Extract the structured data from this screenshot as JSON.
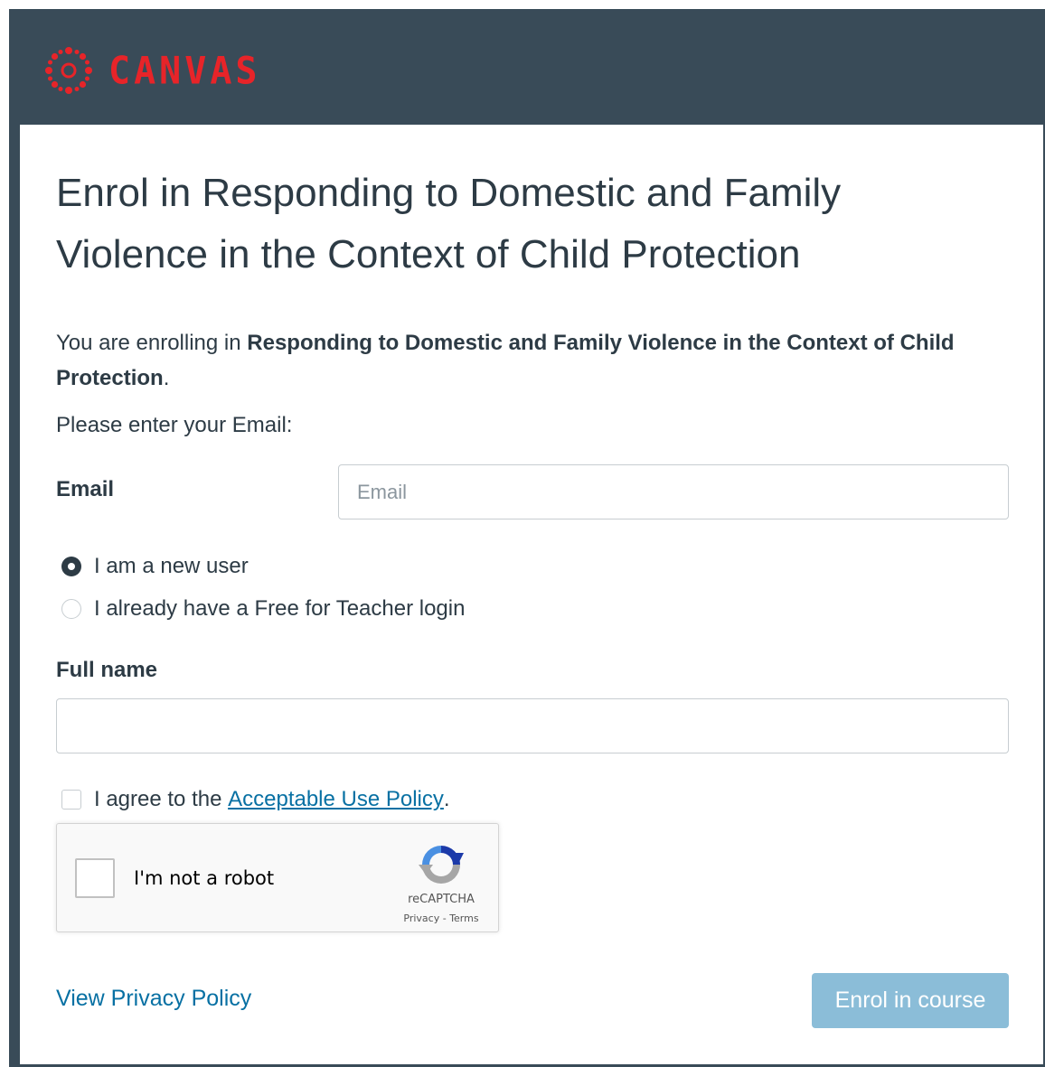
{
  "brand": {
    "name": "CANVAS",
    "color": "#e72429",
    "logo_icon": "canvas-logo-icon"
  },
  "page": {
    "title": "Enrol in Responding to Domestic and Family Violence in the Context of Child Protection",
    "intro_prefix": "You are enrolling in ",
    "course_name": "Responding to Domestic and Family Violence in the Context of Child Protection",
    "intro_suffix": ".",
    "prompt": "Please enter your Email:"
  },
  "form": {
    "email_label": "Email",
    "email_placeholder": "Email",
    "email_value": "",
    "user_options": [
      {
        "label": "I am a new user",
        "selected": true
      },
      {
        "label": "I already have a Free for Teacher login",
        "selected": false
      }
    ],
    "fullname_label": "Full name",
    "fullname_value": "",
    "agree_prefix": "I agree to the ",
    "agree_link": "Acceptable Use Policy",
    "agree_suffix": ".",
    "agree_checked": false
  },
  "captcha": {
    "label": "I'm not a robot",
    "brand": "reCAPTCHA",
    "privacy": "Privacy",
    "separator": " - ",
    "terms": "Terms",
    "checked": false
  },
  "footer": {
    "privacy_link": "View Privacy Policy",
    "submit_label": "Enrol in course"
  },
  "colors": {
    "header_bg": "#394b58",
    "link": "#0770a3",
    "button_disabled": "#8bbdd8"
  }
}
